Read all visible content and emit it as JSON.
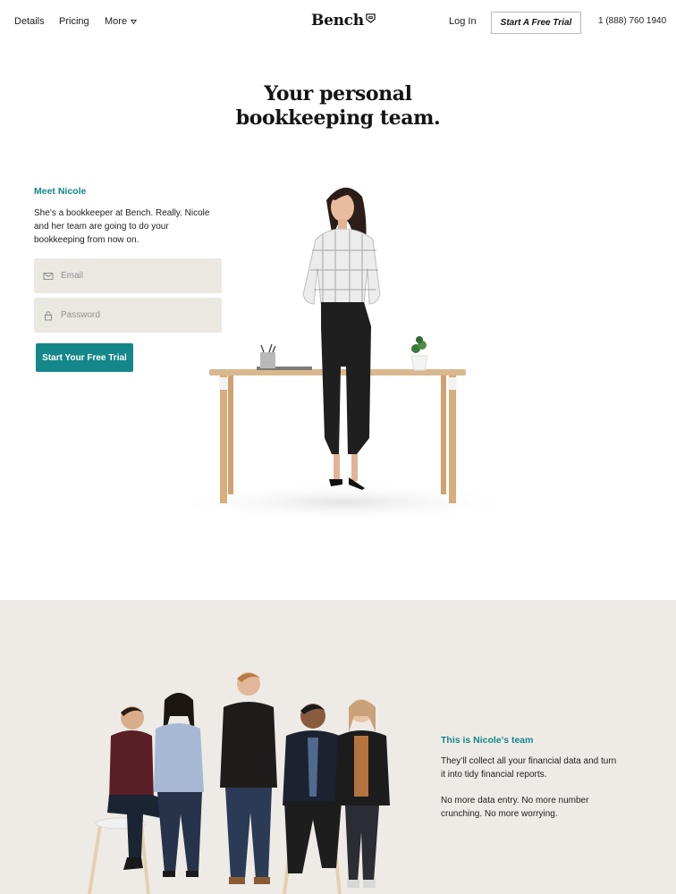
{
  "nav": {
    "details": "Details",
    "pricing": "Pricing",
    "more": "More",
    "brand": "Bench",
    "login": "Log In",
    "trial": "Start A Free Trial",
    "phone": "1 (888) 760 1940"
  },
  "hero": {
    "title_line1": "Your personal",
    "title_line2": "bookkeeping team."
  },
  "signup": {
    "heading": "Meet Nicole",
    "description": "She’s a bookkeeper at Bench. Really. Nicole and her team are going to do your bookkeeping from now on.",
    "email_placeholder": "Email",
    "password_placeholder": "Password",
    "cta": "Start Your Free Trial"
  },
  "team": {
    "heading": "This is Nicole’s team",
    "paragraph1": "They’ll collect all your financial data and turn it into tidy financial reports.",
    "paragraph2": "No more data entry. No more number crunching. No more worrying."
  },
  "colors": {
    "accent": "#14878a",
    "field_bg": "#ebe8e2",
    "section_bg": "#eeebe6"
  },
  "icons": {
    "email": "envelope-icon",
    "password": "lock-icon",
    "more": "chevron-down-icon"
  }
}
